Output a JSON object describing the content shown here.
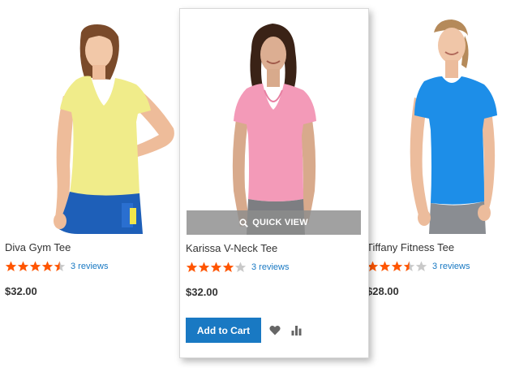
{
  "colors": {
    "accent": "#1979c3",
    "star_filled": "#ff5501",
    "star_empty": "#c9c9c9",
    "quick_view_bg": "#8c8c8c"
  },
  "products": [
    {
      "name": "Diva Gym Tee",
      "rating_stars": 4.5,
      "reviews": "3 reviews",
      "price": "$32.00",
      "image": "woman in yellow v-neck tee and blue pants"
    },
    {
      "name": "Karissa V-Neck Tee",
      "rating_stars": 4,
      "reviews": "3 reviews",
      "price": "$32.00",
      "image": "woman in pink v-neck tee and grey pants",
      "quick_view": "QUICK VIEW",
      "add_to_cart": "Add to Cart",
      "wishlist_icon": "heart-icon",
      "compare_icon": "bar-chart-icon"
    },
    {
      "name": "Tiffany Fitness Tee",
      "rating_stars": 3.5,
      "reviews": "3 reviews",
      "price": "$28.00",
      "image": "woman in blue scoop-neck tee and grey pants"
    }
  ]
}
